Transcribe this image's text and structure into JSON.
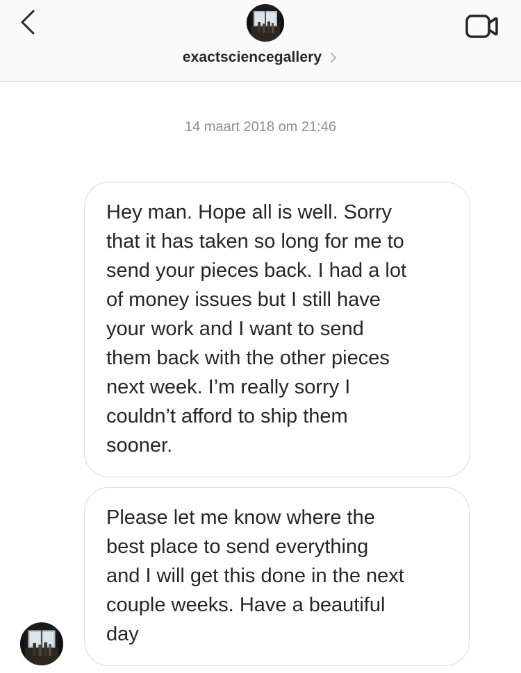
{
  "header": {
    "back_icon": "chevron-left-icon",
    "avatar_icon": "gallery-avatar-photo",
    "username": "exactsciencegallery",
    "username_chevron_icon": "chevron-right-icon",
    "video_icon": "video-camera-icon"
  },
  "thread": {
    "timestamp": "14 maart 2018 om 21:46",
    "messages": [
      {
        "text": "Hey man. Hope all is well. Sorry\nthat it has taken so long for me to\nsend your pieces back. I had a lot\nof money issues but I still have\nyour work and I want to send\nthem back with the other pieces\nnext week. I’m really sorry I\ncouldn’t afford to ship them\nsooner."
      },
      {
        "text": "Please let me know where the\nbest place to send everything\nand I will get this done in the next\ncouple weeks. Have a beautiful\nday"
      }
    ],
    "sender_avatar_icon": "gallery-avatar-photo"
  },
  "colors": {
    "header_bg": "#fafafa",
    "text_primary": "#262626",
    "text_secondary": "#8e8e8e",
    "bubble_border": "#dbdbdb"
  }
}
